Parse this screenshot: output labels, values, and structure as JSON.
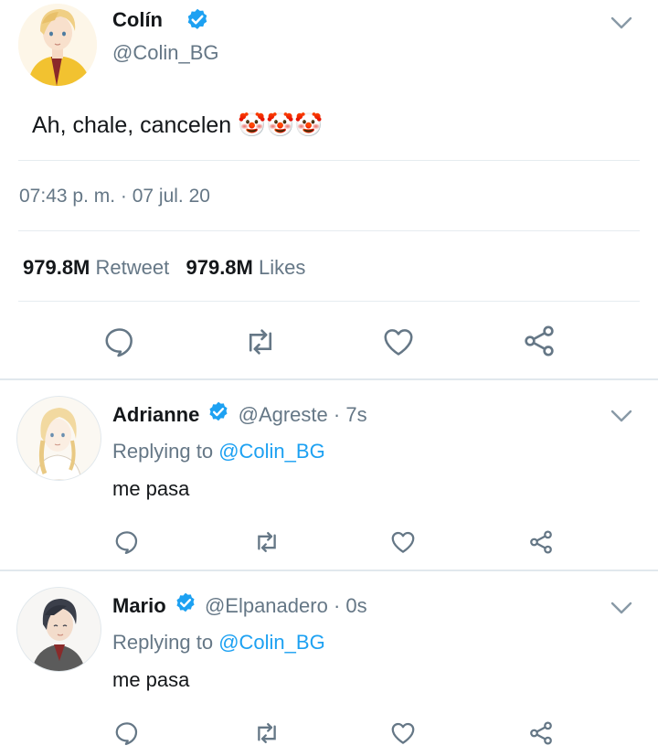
{
  "main_tweet": {
    "display_name": "Colín",
    "handle": "@Colin_BG",
    "text": "Ah, chale, cancelen",
    "emoji": "🤡🤡🤡",
    "timestamp": "07:43 p. m. · 07 jul. 20",
    "retweets_count": "979.8M",
    "retweets_label": "Retweet",
    "likes_count": "979.8M",
    "likes_label": "Likes"
  },
  "replies": [
    {
      "display_name": "Adrianne",
      "handle": "@Agreste",
      "time": "· 7s",
      "replying_label": "Replying to",
      "replying_handle": "@Colin_BG",
      "text": "me pasa"
    },
    {
      "display_name": "Mario",
      "handle": "@Elpanadero",
      "time": "· 0s",
      "replying_label": "Replying to",
      "replying_handle": "@Colin_BG",
      "text": "me pasa"
    }
  ],
  "icons": {
    "reply": "reply-icon",
    "retweet": "retweet-icon",
    "like": "heart-icon",
    "share": "share-icon",
    "menu": "chevron-down-icon",
    "verified": "verified-badge-icon"
  },
  "colors": {
    "accent": "#1da1f2",
    "text": "#14171a",
    "muted": "#657786",
    "divider": "#e6ecf0"
  }
}
